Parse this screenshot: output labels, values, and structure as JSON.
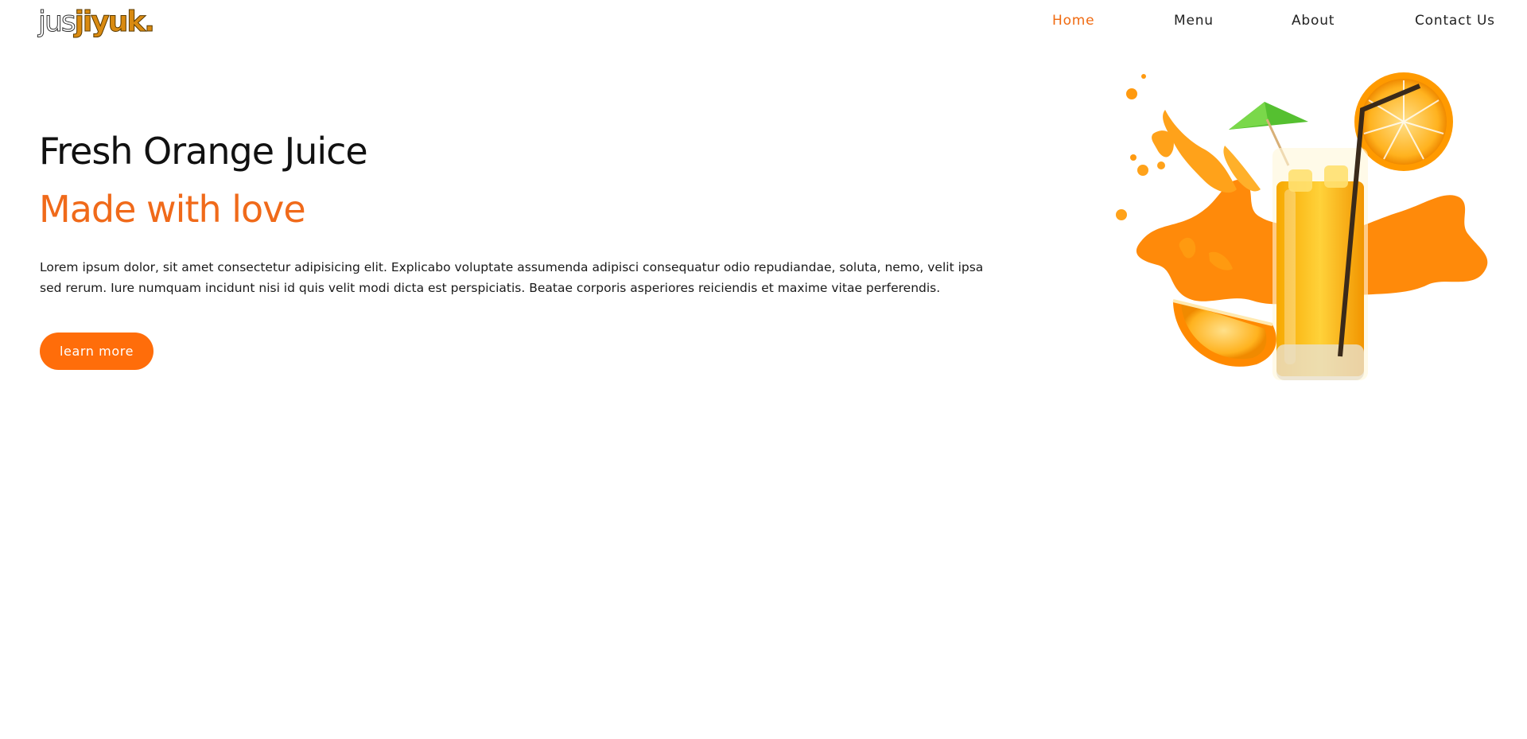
{
  "logo": {
    "part1": "jus",
    "part2": "jiyuk."
  },
  "nav": {
    "items": [
      {
        "label": "Home",
        "active": true
      },
      {
        "label": "Menu",
        "active": false
      },
      {
        "label": "About",
        "active": false
      },
      {
        "label": "Contact Us",
        "active": false
      }
    ]
  },
  "hero": {
    "title": "Fresh Orange Juice",
    "subtitle": "Made with love",
    "text": "Lorem ipsum dolor, sit amet consectetur adipisicing elit. Explicabo voluptate assumenda adipisci consequatur odio repudiandae, soluta, nemo, velit ipsa sed rerum. Iure numquam incidunt nisi id quis velit modi dicta est perspiciatis. Beatae corporis asperiores reiciendis et maxime vitae perferendis.",
    "cta_label": "learn more"
  },
  "colors": {
    "accent": "#f06a1a",
    "button": "#ff6d0a",
    "text": "#111111",
    "background": "#ffffff"
  },
  "illustration": {
    "icon": "orange-juice-glass-illustration"
  }
}
